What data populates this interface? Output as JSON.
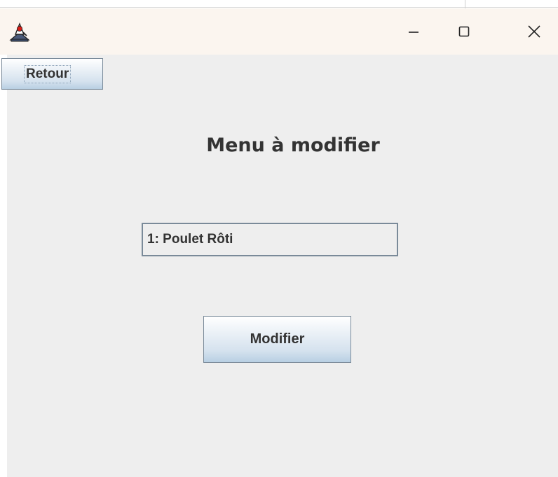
{
  "window": {
    "app_icon": "java-duke-icon",
    "controls": {
      "minimize": "minimize-icon",
      "maximize": "maximize-icon",
      "close": "close-icon"
    }
  },
  "content": {
    "back_label": "Retour",
    "heading": "Menu à modifier",
    "menu_select": {
      "selected_value": "1: Poulet Rôti"
    },
    "submit_label": "Modifier"
  }
}
